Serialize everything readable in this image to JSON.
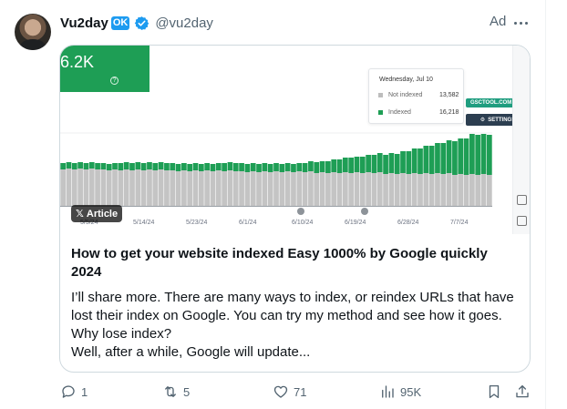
{
  "author": {
    "name": "Vu2day",
    "badge": "OK",
    "handle": "@vu2day"
  },
  "ad_label": "Ad",
  "card": {
    "image": {
      "headline_number": "6.2K",
      "tooltip": {
        "date": "Wednesday, Jul 10",
        "rows": [
          {
            "label": "Not indexed",
            "value": "13,582",
            "color": "#bdbdbd"
          },
          {
            "label": "Indexed",
            "value": "16,218",
            "color": "#1e9e55"
          }
        ]
      },
      "gsc_badge": "GSCTOOL.COM",
      "settings_badge": "SETTINGS",
      "x_ticks": [
        "5/5/24",
        "5/14/24",
        "5/23/24",
        "6/1/24",
        "6/10/24",
        "6/19/24",
        "6/28/24",
        "7/7/24"
      ],
      "colors": {
        "indexed": "#1e9e55",
        "not_indexed": "#c4c4c4"
      }
    },
    "article_pill": "Article",
    "title": "How to get your website indexed Easy 1000% by Google quickly 2024",
    "description_lines": [
      "I’ll share more. There are many ways to index, or reindex URLs that have",
      "lost their index on Google. You can try my method and see how it goes.",
      "Why lose index?",
      "Well, after a while, Google will update..."
    ]
  },
  "actions": {
    "replies": "1",
    "reposts": "5",
    "likes": "71",
    "views": "95K"
  },
  "icons": {
    "verified": "verified-badge-icon",
    "more": "more-dots-icon",
    "reply": "reply-icon",
    "repost": "repost-icon",
    "like": "heart-icon",
    "views": "views-chart-icon",
    "bookmark": "bookmark-icon",
    "share": "share-icon"
  },
  "colors": {
    "accent": "#1d9bf0",
    "secondary_text": "#536471"
  }
}
